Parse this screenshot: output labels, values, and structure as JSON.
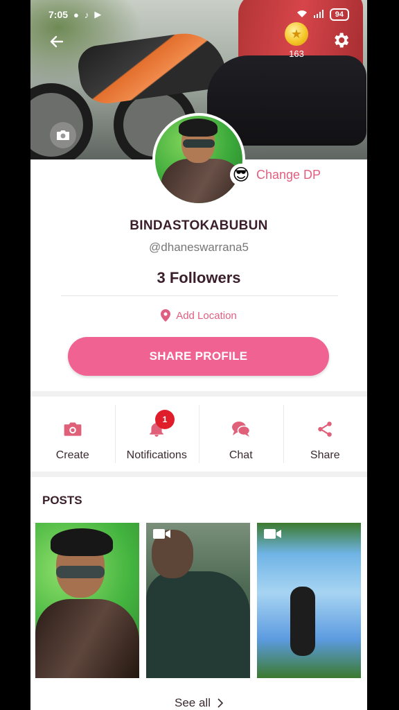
{
  "status_bar": {
    "time": "7:05",
    "battery": "94"
  },
  "header": {
    "coin_count": "163"
  },
  "profile": {
    "change_dp_label": "Change DP",
    "change_dp_emoji": "😎",
    "username": "BINDASTOKABUBUN",
    "handle": "@dhaneswarrana5",
    "followers": "3 Followers",
    "add_location_label": "Add Location",
    "share_profile_label": "SHARE PROFILE"
  },
  "actions": [
    {
      "label": "Create",
      "icon": "camera-icon"
    },
    {
      "label": "Notifications",
      "icon": "bell-icon",
      "badge": "1"
    },
    {
      "label": "Chat",
      "icon": "chat-icon"
    },
    {
      "label": "Share",
      "icon": "share-icon"
    }
  ],
  "posts": {
    "title": "POSTS",
    "items": [
      {
        "type": "photo"
      },
      {
        "type": "video"
      },
      {
        "type": "video"
      }
    ],
    "see_all_label": "See all"
  },
  "colors": {
    "accent": "#f06292",
    "accent_text": "#e05f80",
    "badge": "#e01e2b"
  }
}
